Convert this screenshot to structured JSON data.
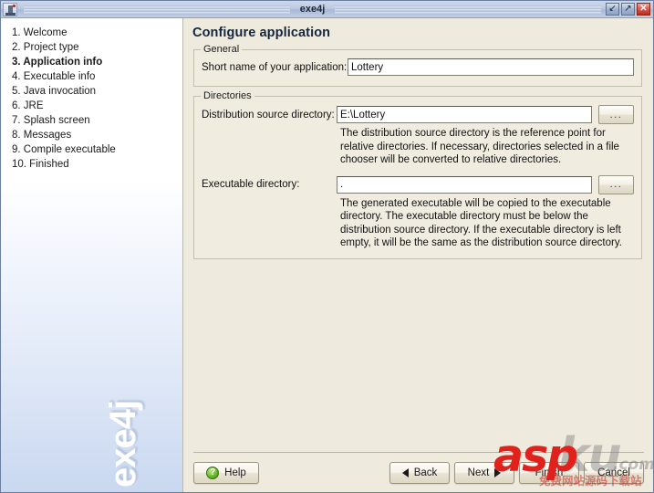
{
  "window": {
    "title": "exe4j",
    "icon": "app-icon",
    "buttons": {
      "minimize": "↙",
      "maximize": "↗",
      "close": "✕"
    }
  },
  "sidebar": {
    "brand": "exe4j",
    "steps": [
      {
        "label": "1. Welcome",
        "active": false
      },
      {
        "label": "2. Project type",
        "active": false
      },
      {
        "label": "3. Application info",
        "active": true
      },
      {
        "label": "4. Executable info",
        "active": false
      },
      {
        "label": "5. Java invocation",
        "active": false
      },
      {
        "label": "6. JRE",
        "active": false
      },
      {
        "label": "7. Splash screen",
        "active": false
      },
      {
        "label": "8. Messages",
        "active": false
      },
      {
        "label": "9. Compile executable",
        "active": false
      },
      {
        "label": "10. Finished",
        "active": false
      }
    ]
  },
  "main": {
    "page_title": "Configure application",
    "general": {
      "group_title": "General",
      "short_name_label": "Short name of your application:",
      "short_name_value": "Lottery"
    },
    "directories": {
      "group_title": "Directories",
      "distribution_label": "Distribution source directory:",
      "distribution_value": "E:\\Lottery",
      "distribution_help": "The distribution source directory is the reference point for relative directories. If necessary, directories selected in a file chooser will be converted to relative directories.",
      "executable_label": "Executable directory:",
      "executable_value": ".",
      "executable_help": "The generated executable will be copied to the executable directory. The executable directory must be below the distribution source directory. If the executable directory is left empty, it will be the same as the distribution source directory.",
      "browse_label": "..."
    }
  },
  "footer": {
    "help_label": "Help",
    "help_icon": "question-mark",
    "back_label": "Back",
    "next_label": "Next",
    "finish_label": "Finish",
    "cancel_label": "Cancel"
  },
  "watermark": {
    "part_red": "asp",
    "part_gray": "ku",
    "part_com": ".com",
    "part_cn": "免费网站源码下载站"
  },
  "colors": {
    "panel_bg": "#eeeade",
    "group_bg": "#f0ece0",
    "title_text": "#14263d",
    "accent_red": "#e1211b",
    "help_green": "#6cba30"
  }
}
